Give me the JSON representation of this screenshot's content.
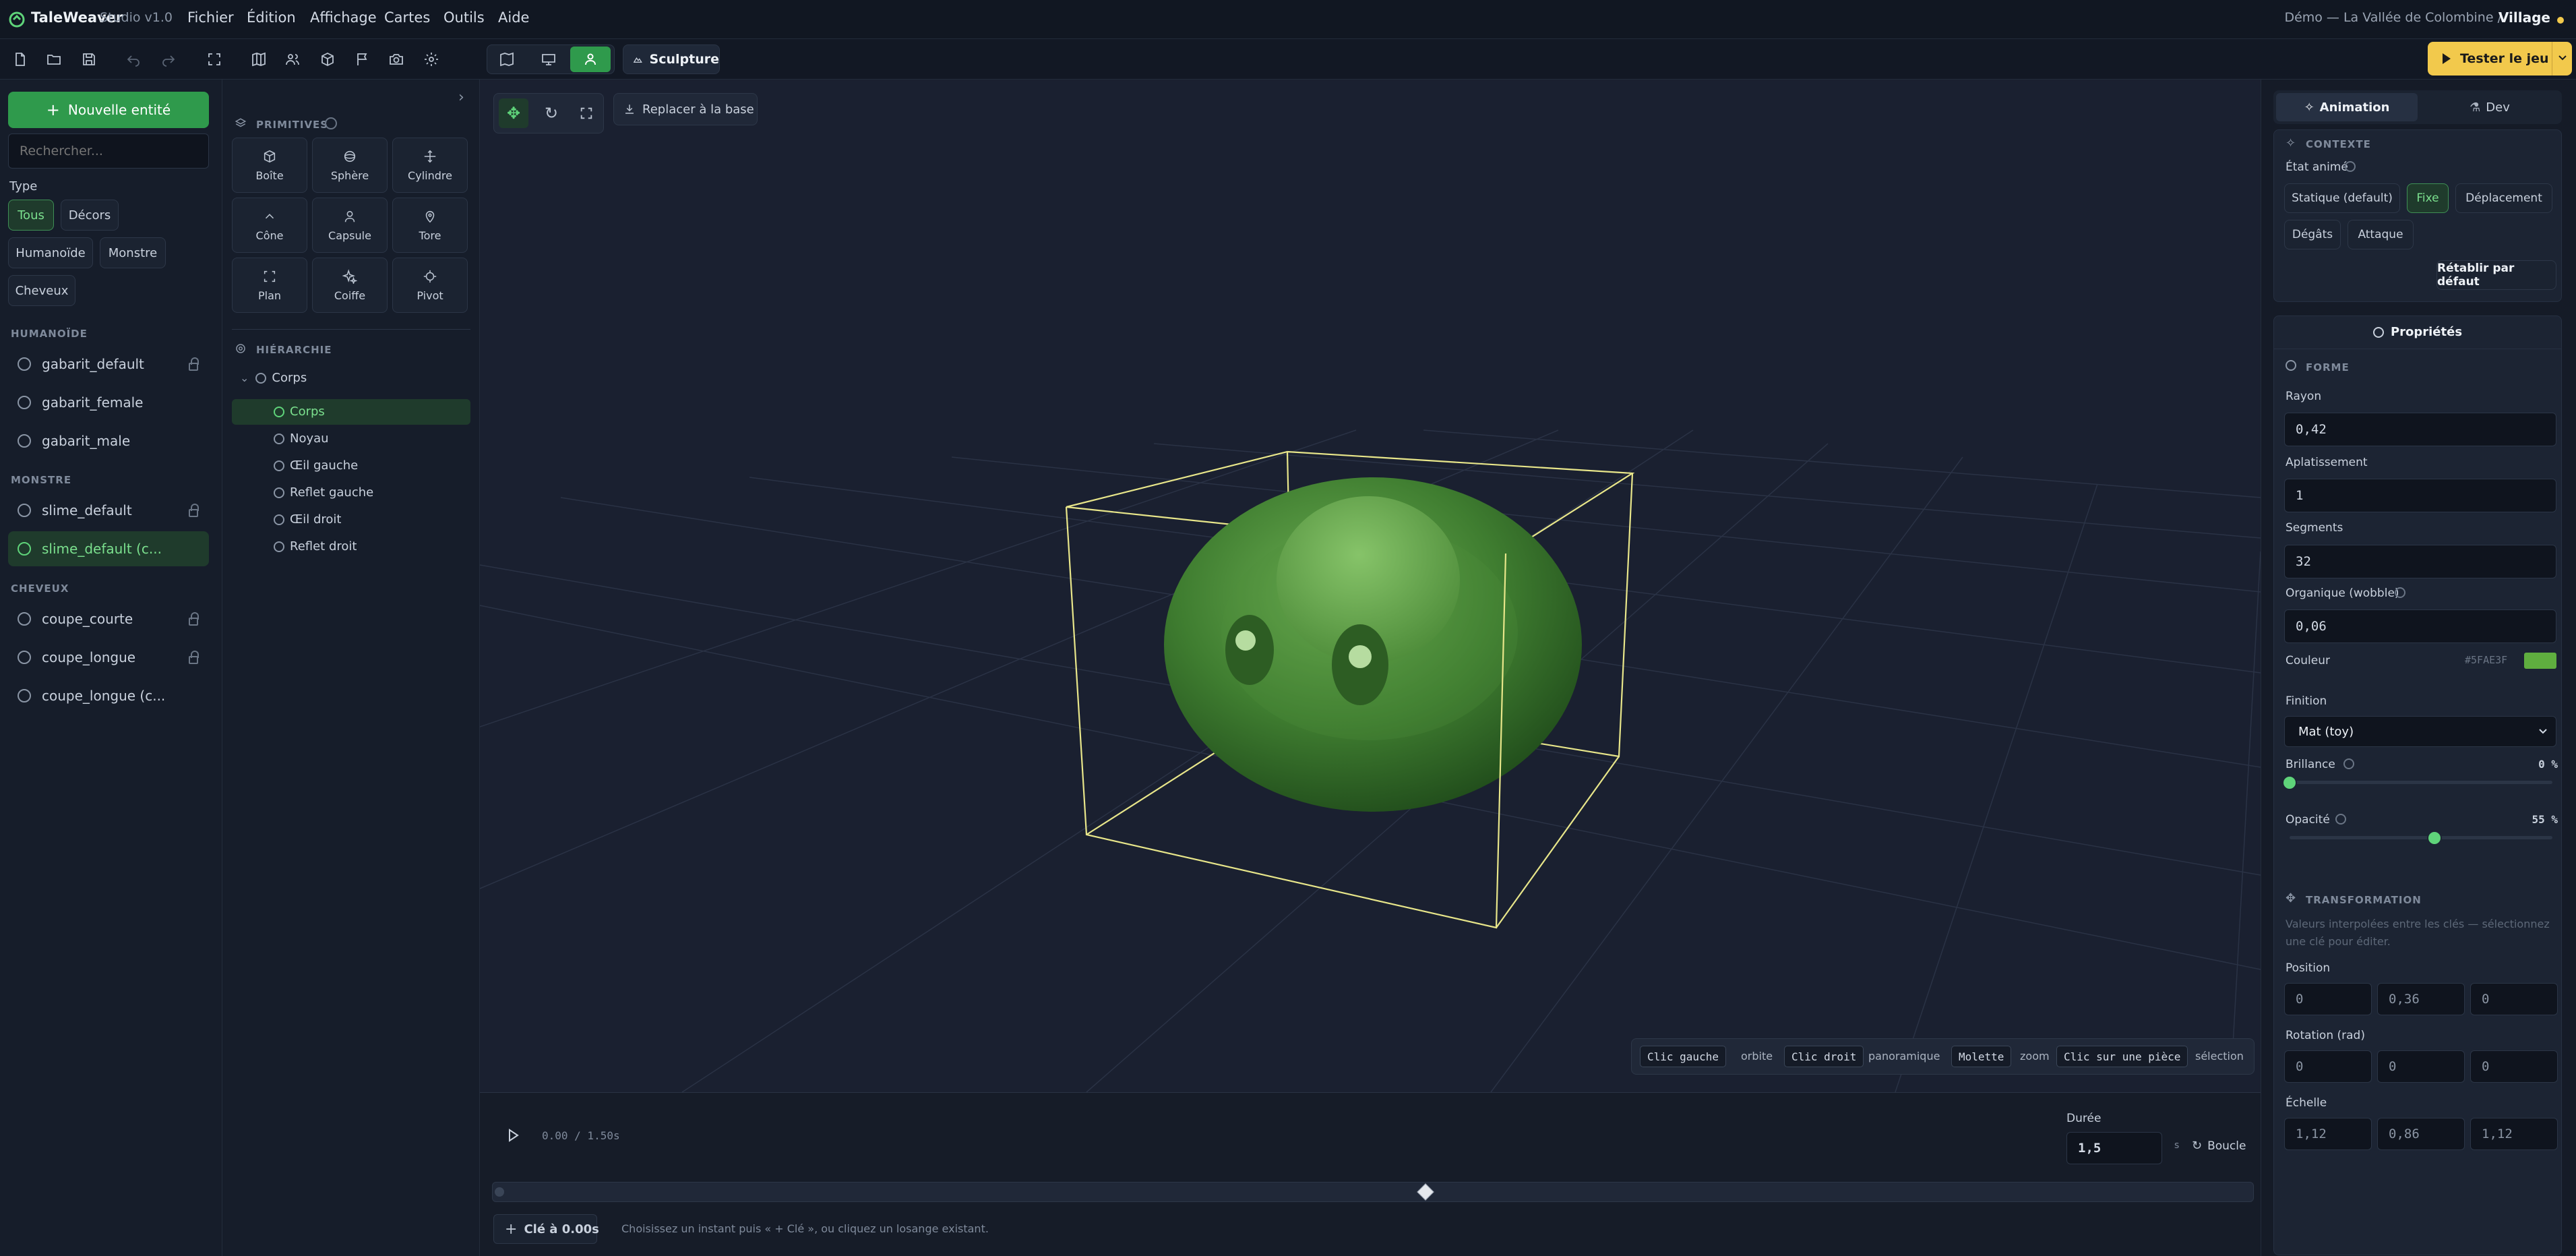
{
  "app": {
    "name": "TaleWeaver",
    "studio": "Studio v1.0",
    "project": "Démo — La Vallée de Colombine",
    "separator": "/",
    "scene": "Village"
  },
  "menu": [
    "Fichier",
    "Édition",
    "Affichage",
    "Cartes",
    "Outils",
    "Aide"
  ],
  "toolbar": {
    "mode_label": "Sculpture",
    "play_button": "Tester le jeu"
  },
  "left": {
    "new_button": "Nouvelle entité",
    "search_placeholder": "Rechercher...",
    "type_label": "Type",
    "filters": [
      "Tous",
      "Décors",
      "Humanoïde",
      "Monstre",
      "Cheveux"
    ],
    "groups": [
      {
        "title": "HUMANOÏDE",
        "items": [
          {
            "name": "gabarit_default",
            "locked": true
          },
          {
            "name": "gabarit_female",
            "locked": false
          },
          {
            "name": "gabarit_male",
            "locked": false
          }
        ]
      },
      {
        "title": "MONSTRE",
        "items": [
          {
            "name": "slime_default",
            "locked": true
          },
          {
            "name": "slime_default (c...",
            "locked": false,
            "selected": true
          }
        ]
      },
      {
        "title": "CHEVEUX",
        "items": [
          {
            "name": "coupe_courte",
            "locked": true
          },
          {
            "name": "coupe_longue",
            "locked": true
          },
          {
            "name": "coupe_longue (c...",
            "locked": false
          }
        ]
      }
    ]
  },
  "primitives": {
    "title": "PRIMITIVES",
    "items": [
      "Boîte",
      "Sphère",
      "Cylindre",
      "Cône",
      "Capsule",
      "Tore",
      "Plan",
      "Coiffe",
      "Pivot"
    ]
  },
  "hierarchy": {
    "title": "HIÉRARCHIE",
    "root": "Corps",
    "children": [
      "Corps",
      "Noyau",
      "Œil gauche",
      "Reflet gauche",
      "Œil droit",
      "Reflet droit"
    ]
  },
  "viewport": {
    "reset_button": "Replacer à la base",
    "hints": [
      {
        "key": "Clic gauche",
        "action": "orbite"
      },
      {
        "key": "Clic droit",
        "action": "panoramique"
      },
      {
        "key": "Molette",
        "action": "zoom"
      },
      {
        "key": "Clic sur une pièce",
        "action": "sélection"
      }
    ]
  },
  "timeline": {
    "time": "0.00 / 1.50s",
    "duration_label": "Durée",
    "duration_value": "1,5",
    "duration_unit": "s",
    "loop_label": "Boucle",
    "key_button": "Clé à 0.00s",
    "hint": "Choisissez un instant puis « + Clé », ou cliquez un losange existant.",
    "key_position": 0.53
  },
  "right": {
    "tabs": [
      "Animation",
      "Dev"
    ],
    "context_title": "CONTEXTE",
    "state_label": "État animé",
    "states": [
      "Statique (default)",
      "Fixe",
      "Déplacement",
      "Dégâts",
      "Attaque"
    ],
    "reset_button": "Rétablir par défaut",
    "props_title": "Propriétés",
    "shape_title": "FORME",
    "rayon_label": "Rayon",
    "rayon": "0,42",
    "aplat_label": "Aplatissement",
    "aplat": "1",
    "segments_label": "Segments",
    "segments": "32",
    "wobble_label": "Organique (wobble)",
    "wobble": "0,06",
    "color_label": "Couleur",
    "color_hex": "#5FAE3F",
    "color_swatch": "#5fae3f",
    "finish_label": "Finition",
    "finish": "Mat (toy)",
    "shine_label": "Brillance",
    "shine": "0 %",
    "shine_value": 0,
    "opacity_label": "Opacité",
    "opacity": "55 %",
    "opacity_value": 0.55,
    "transform_title": "TRANSFORMATION",
    "transform_hint": "Valeurs interpolées entre les clés — sélectionnez une clé pour éditer.",
    "position_label": "Position",
    "position": [
      "0",
      "0,36",
      "0"
    ],
    "rotation_label": "Rotation (rad)",
    "rotation": [
      "0",
      "0",
      "0"
    ],
    "scale_label": "Échelle",
    "scale": [
      "1,12",
      "0,86",
      "1,12"
    ]
  }
}
